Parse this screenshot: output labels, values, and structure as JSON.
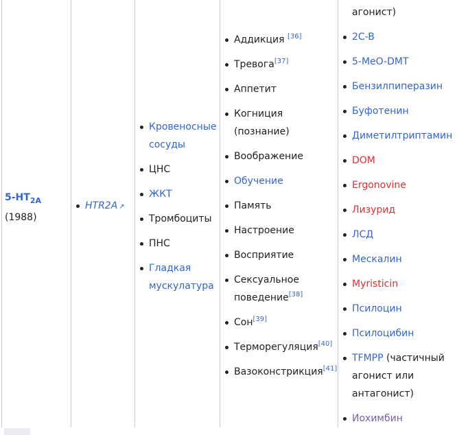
{
  "receptor": {
    "name": "5-HT",
    "sub": "2A",
    "year": "(1988)"
  },
  "gene": {
    "label": "HTR2A",
    "icon": "external-link-icon"
  },
  "tissues": [
    {
      "text": "Кровеносные сосуды",
      "link": true
    },
    {
      "text": "ЦНС",
      "link": false
    },
    {
      "text": "ЖКТ",
      "link": true
    },
    {
      "text": "Тромбоциты",
      "link": false
    },
    {
      "text": "ПНС",
      "link": false
    },
    {
      "text": "Гладкая мускулатура",
      "link": true
    }
  ],
  "functions": [
    {
      "text": "Аддикция ",
      "ref": "[36]"
    },
    {
      "text": "Тревога",
      "ref": "[37]"
    },
    {
      "text": "Аппетит",
      "ref": ""
    },
    {
      "text": "Когниция (познание)",
      "ref": ""
    },
    {
      "text": "Воображение",
      "ref": ""
    },
    {
      "text": "Обучение",
      "ref": "",
      "link": true
    },
    {
      "text": "Память",
      "ref": ""
    },
    {
      "text": "Настроение",
      "ref": ""
    },
    {
      "text": "Восприятие",
      "ref": ""
    },
    {
      "text": "Сексуальное поведение",
      "ref": "[38]"
    },
    {
      "text": "Сон",
      "ref": "[39]"
    },
    {
      "text": "Терморегуляция",
      "ref": "[40]"
    },
    {
      "text": "Вазоконстрикция",
      "ref": "[41]"
    }
  ],
  "agonists_continued": "агонист)",
  "agonists": [
    {
      "text": "2C-B",
      "style": "blue"
    },
    {
      "text": "5-MeO-DMT",
      "style": "blue"
    },
    {
      "text": "Бензилпиперазин",
      "style": "blue"
    },
    {
      "text": "Буфотенин",
      "style": "blue"
    },
    {
      "text": "Диметилтриптамин",
      "style": "blue"
    },
    {
      "text": "DOM",
      "style": "red"
    },
    {
      "text": "Ergonovine",
      "style": "red"
    },
    {
      "text": "Лизурид",
      "style": "red"
    },
    {
      "text": "ЛСД",
      "style": "blue"
    },
    {
      "text": "Мескалин",
      "style": "blue"
    },
    {
      "text": "Myristicin",
      "style": "red"
    },
    {
      "text": "Псилоцин",
      "style": "blue"
    },
    {
      "text": "Псилоцибин",
      "style": "blue"
    },
    {
      "text": "TFMPP",
      "style": "blue",
      "note": " (частичный агонист или антагонист)"
    },
    {
      "text": "Иохимбин",
      "style": "visited"
    }
  ]
}
